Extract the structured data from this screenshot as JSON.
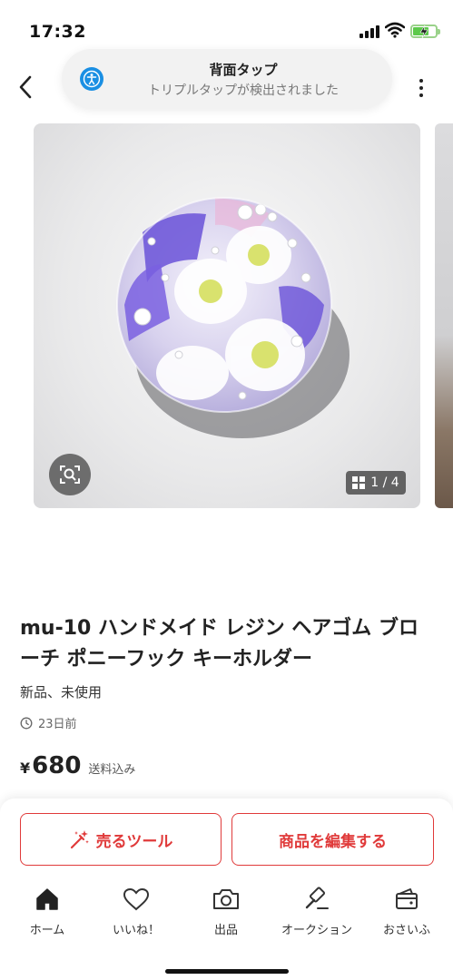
{
  "status_bar": {
    "time": "17:32"
  },
  "banner": {
    "title": "背面タップ",
    "subtitle": "トリプルタップが検出されました"
  },
  "gallery": {
    "counter": "1 / 4"
  },
  "product": {
    "title": "mu-10 ハンドメイド レジン ヘアゴム ブローチ ポニーフック キーホルダー",
    "condition": "新品、未使用",
    "posted": "23日前",
    "currency": "¥",
    "price": "680",
    "shipping": "送料込み"
  },
  "actions": {
    "sell_tool": "売るツール",
    "edit": "商品を編集する"
  },
  "tabs": [
    {
      "label": "ホーム",
      "icon": "home-icon"
    },
    {
      "label": "いいね！",
      "icon": "heart-icon"
    },
    {
      "label": "出品",
      "icon": "camera-icon"
    },
    {
      "label": "オークション",
      "icon": "gavel-icon"
    },
    {
      "label": "おさいふ",
      "icon": "wallet-icon"
    }
  ],
  "colors": {
    "accent": "#e03a3a",
    "banner_icon": "#1a8fe3"
  }
}
